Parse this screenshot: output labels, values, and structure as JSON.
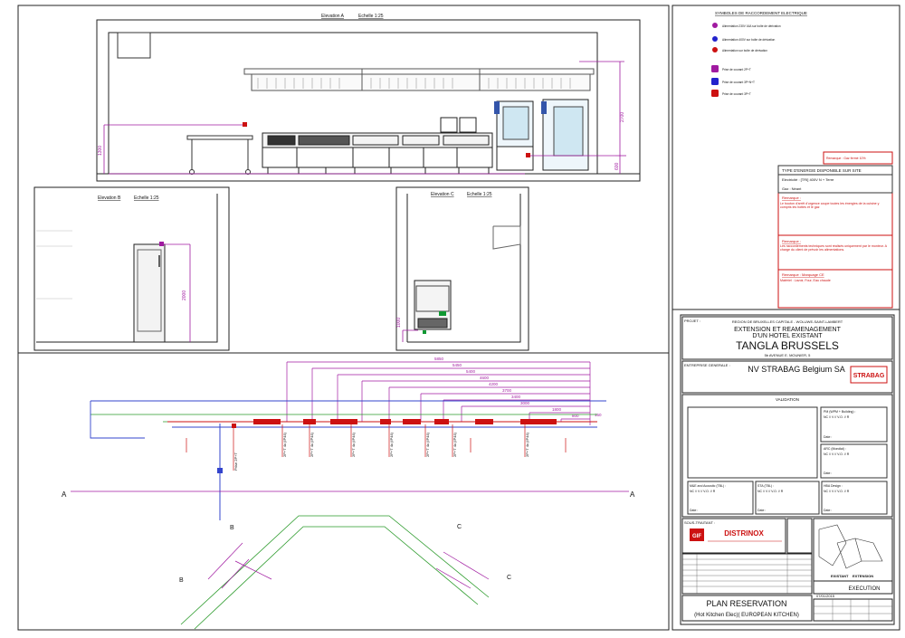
{
  "elevation_a": {
    "title": "Elevation A",
    "scale": "Echelle 1:25",
    "dim_height": "1300",
    "dim_total": "2700",
    "dim_small": "600"
  },
  "elevation_b": {
    "title": "Elevation B",
    "scale": "Echelle 1:25",
    "dim": "2000"
  },
  "elevation_c": {
    "title": "Elevation C",
    "scale": "Echelle 1:25",
    "dim": "1000"
  },
  "plan": {
    "section_label": "A",
    "section_b": "B",
    "section_c": "C",
    "dims_top": [
      "5850",
      "5450",
      "5400",
      "4600",
      "4200",
      "3700",
      "3400",
      "3000",
      "1800",
      "800",
      "150"
    ],
    "outlet_labels": [
      "Prise 2P+T",
      "2P+T 4x (IP44)",
      "2P+T 4x (IP44)",
      "2P+T 4x (IP44)",
      "2P+T 4x (IP44)",
      "2P+T 4x (IP44)",
      "2P+T 4x (IP44)",
      "2P+T 4x (IP44)"
    ]
  },
  "legend": {
    "title": "SYMBOLES DE RACCORDEMENT ELECTRIQUE",
    "items": [
      {
        "icon": "power-point-icon",
        "color": "#a01aa0",
        "text": "Alimentation 230V 16A sur boîte de dérivation"
      },
      {
        "icon": "three-phase-icon",
        "color": "#2222cc",
        "text": "Alimentation 400V sur boîte de dérivation"
      },
      {
        "icon": "junction-icon",
        "color": "#cc1111",
        "text": "Alimentation sur boîte de dérivation"
      },
      {
        "icon": "socket-magenta-icon",
        "color": "#a01aa0",
        "text": "Prise de courant 2P+T"
      },
      {
        "icon": "socket-blue-icon",
        "color": "#2222cc",
        "text": "Prise de courant 3P+N+T"
      },
      {
        "icon": "socket-red-icon",
        "color": "#cc1111",
        "text": "Prise de courant 3P+T"
      }
    ]
  },
  "energy": {
    "remark_top": "Remarque : Gaz fermé 10%",
    "header": "TYPE D'ENERGIE DISPONIBLE SUR SITE",
    "line1": "Electricité : [TRI] 400V N + Terre",
    "line2": "Gaz : Néant",
    "remark1_title": "Remarque :",
    "remark1_text": "Le bouton d'arrêt d'urgence coupe toutes les énergies de la cuisine y compris les hottes et le gaz",
    "remark2_title": "Remarque :",
    "remark2_text": "Les raccordements techniques sont réalisés uniquement par le monteur. A charge du client de prévoir les alimentations.",
    "remark3_title": "Remarque : Marquage CE",
    "remark3_text": "Matériel : Lavoir, Four, Eau chaude"
  },
  "title_block": {
    "projet_label": "PROJET :",
    "region": "REGION DE BRUXELLES CAPITALE - WOLUWE-SAINT-LAMBERT",
    "project_line1": "EXTENSION ET REAMENAGEMENT",
    "project_line2": "D'UN HOTEL EXISTANT",
    "hotel": "TANGLA BRUSSELS",
    "address": "5b AVENUE E. MOUNIER, 5",
    "entreprise_label": "ENTREPRISE GENERALE :",
    "company": "NV STRABAG Belgium SA",
    "company_logo": "STRABAG",
    "validation": "VALIDATION",
    "stamp1": "PM (WPM + Building) :",
    "stamp2": "ARC (Mondial) :",
    "stamp3": "M&E and Acoustic (TBL) :",
    "stamp4": "STA (TBL) :",
    "stamp5": "HBA Design :",
    "stamp_codes": "NC // V // V.O. // R",
    "date_label": "Date :",
    "subcontractor_label": "SOUS-TRAITANT :",
    "distrinox": "DISTRINOX",
    "gif": "GIF",
    "existant": "EXISTANT",
    "extension": "EXTENSION",
    "phase": "EXECUTION",
    "date": "07/01/2015",
    "plan_title": "PLAN RESERVATION",
    "plan_subtitle": "(Hot Kitchen Elec)( EUROPEAN KITCHEN)"
  }
}
